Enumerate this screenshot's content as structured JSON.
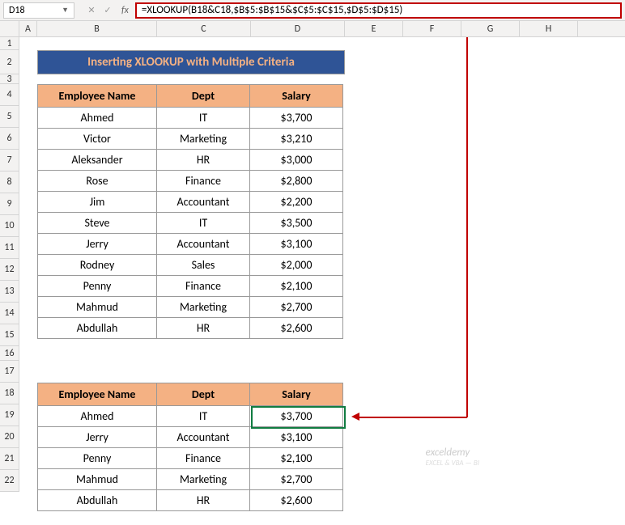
{
  "nameBox": "D18",
  "formula": "=XLOOKUP(B18&C18,$B$5:$B$15&$C$5:$C$15,$D$5:$D$15)",
  "fxLabel": "fx",
  "columns": [
    "A",
    "B",
    "C",
    "D",
    "E",
    "F",
    "G",
    "H"
  ],
  "rows": [
    "1",
    "2",
    "3",
    "4",
    "5",
    "6",
    "7",
    "8",
    "9",
    "10",
    "11",
    "12",
    "13",
    "14",
    "15",
    "16",
    "17",
    "18",
    "19",
    "20",
    "21",
    "22"
  ],
  "title": "Inserting XLOOKUP with Multiple Criteria",
  "headers": {
    "name": "Employee Name",
    "dept": "Dept",
    "sal": "Salary"
  },
  "table1": [
    {
      "name": "Ahmed",
      "dept": "IT",
      "sal": "$3,700"
    },
    {
      "name": "Victor",
      "dept": "Marketing",
      "sal": "$3,210"
    },
    {
      "name": "Aleksander",
      "dept": "HR",
      "sal": "$3,000"
    },
    {
      "name": "Rose",
      "dept": "Finance",
      "sal": "$2,800"
    },
    {
      "name": "Jim",
      "dept": "Accountant",
      "sal": "$2,200"
    },
    {
      "name": "Steve",
      "dept": "IT",
      "sal": "$3,500"
    },
    {
      "name": "Jerry",
      "dept": "Accountant",
      "sal": "$3,100"
    },
    {
      "name": "Rodney",
      "dept": "Sales",
      "sal": "$2,000"
    },
    {
      "name": "Penny",
      "dept": "Finance",
      "sal": "$2,100"
    },
    {
      "name": "Mahmud",
      "dept": "Marketing",
      "sal": "$2,700"
    },
    {
      "name": "Abdullah",
      "dept": "HR",
      "sal": "$2,600"
    }
  ],
  "table2": [
    {
      "name": "Ahmed",
      "dept": "IT",
      "sal": "$3,700"
    },
    {
      "name": "Jerry",
      "dept": "Accountant",
      "sal": "$3,100"
    },
    {
      "name": "Penny",
      "dept": "Finance",
      "sal": "$2,100"
    },
    {
      "name": "Mahmud",
      "dept": "Marketing",
      "sal": "$2,700"
    },
    {
      "name": "Abdullah",
      "dept": "HR",
      "sal": "$2,600"
    }
  ],
  "watermark": {
    "main": "exceldemy",
    "sub": "EXCEL & VBA — BI"
  }
}
